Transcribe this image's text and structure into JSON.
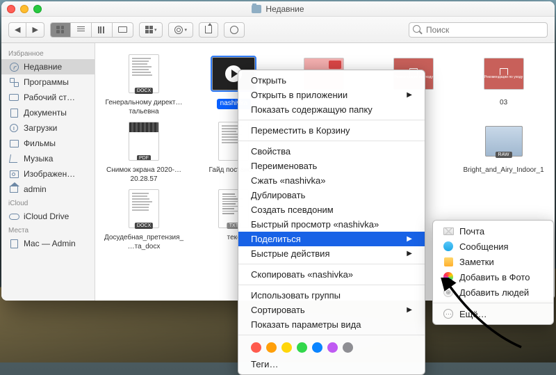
{
  "window": {
    "title": "Недавние"
  },
  "toolbar": {
    "search_placeholder": "Поиск"
  },
  "sidebar": {
    "sections": [
      {
        "heading": "Избранное",
        "items": [
          {
            "label": "Недавние",
            "icon": "clock-icon",
            "selected": true
          },
          {
            "label": "Программы",
            "icon": "apps-icon"
          },
          {
            "label": "Рабочий ст…",
            "icon": "desktop-icon"
          },
          {
            "label": "Документы",
            "icon": "docs-icon"
          },
          {
            "label": "Загрузки",
            "icon": "download-icon"
          },
          {
            "label": "Фильмы",
            "icon": "film-icon"
          },
          {
            "label": "Музыка",
            "icon": "music-icon"
          },
          {
            "label": "Изображен…",
            "icon": "picture-icon"
          },
          {
            "label": "admin",
            "icon": "home-icon"
          }
        ]
      },
      {
        "heading": "iCloud",
        "items": [
          {
            "label": "iCloud Drive",
            "icon": "cloud-icon"
          }
        ]
      },
      {
        "heading": "Места",
        "items": [
          {
            "label": "Mac — Admin",
            "icon": "disk-icon"
          }
        ]
      }
    ]
  },
  "files": [
    {
      "name": "Генеральному директ…тальевна",
      "type": "docx",
      "badge": "DOCX"
    },
    {
      "name": "nashivka",
      "type": "video",
      "selected": true
    },
    {
      "name": "",
      "type": "image-pink"
    },
    {
      "name": "",
      "type": "image-rec",
      "rec_text": "Рекомендации по уходу"
    },
    {
      "name": "03",
      "type": "image-rec",
      "rec_text": "Рекомендации по уходу"
    },
    {
      "name": "Снимок экрана 2020-…20.28.57",
      "type": "pdf",
      "badge": "PDF"
    },
    {
      "name": "Гайд постано…",
      "type": "docx-img"
    },
    {
      "name": "",
      "type": "hidden"
    },
    {
      "name": "",
      "type": "hidden"
    },
    {
      "name": "Bright_and_Airy_Indoor_1",
      "type": "raw",
      "badge": "RAW"
    },
    {
      "name": "Досудебная_претензия_…та_docx",
      "type": "docx",
      "badge": "DOCX"
    },
    {
      "name": "текс",
      "type": "txt",
      "badge": "TXT"
    }
  ],
  "context_menu": {
    "groups": [
      [
        {
          "label": "Открыть"
        },
        {
          "label": "Открыть в приложении",
          "submenu": true
        },
        {
          "label": "Показать содержащую папку"
        }
      ],
      [
        {
          "label": "Переместить в Корзину"
        }
      ],
      [
        {
          "label": "Свойства"
        },
        {
          "label": "Переименовать"
        },
        {
          "label": "Сжать «nashivka»"
        },
        {
          "label": "Дублировать"
        },
        {
          "label": "Создать псевдоним"
        },
        {
          "label": "Быстрый просмотр «nashivka»"
        },
        {
          "label": "Поделиться",
          "submenu": true,
          "highlighted": true
        },
        {
          "label": "Быстрые действия",
          "submenu": true
        }
      ],
      [
        {
          "label": "Скопировать «nashivka»"
        }
      ],
      [
        {
          "label": "Использовать группы"
        },
        {
          "label": "Сортировать",
          "submenu": true
        },
        {
          "label": "Показать параметры вида"
        }
      ]
    ],
    "tag_colors": [
      "#ff5a4d",
      "#ff9f0a",
      "#ffd60a",
      "#32d74b",
      "#0a84ff",
      "#bf5af2",
      "#8e8e93"
    ],
    "tags_label": "Теги…"
  },
  "share_submenu": [
    {
      "label": "Почта",
      "icon": "mail"
    },
    {
      "label": "Сообщения",
      "icon": "messages"
    },
    {
      "label": "Заметки",
      "icon": "notes"
    },
    {
      "label": "Добавить в Фото",
      "icon": "photos"
    },
    {
      "label": "Добавить людей",
      "icon": "people"
    },
    {
      "label": "Ещё…",
      "icon": "more",
      "sep_before": true
    }
  ]
}
